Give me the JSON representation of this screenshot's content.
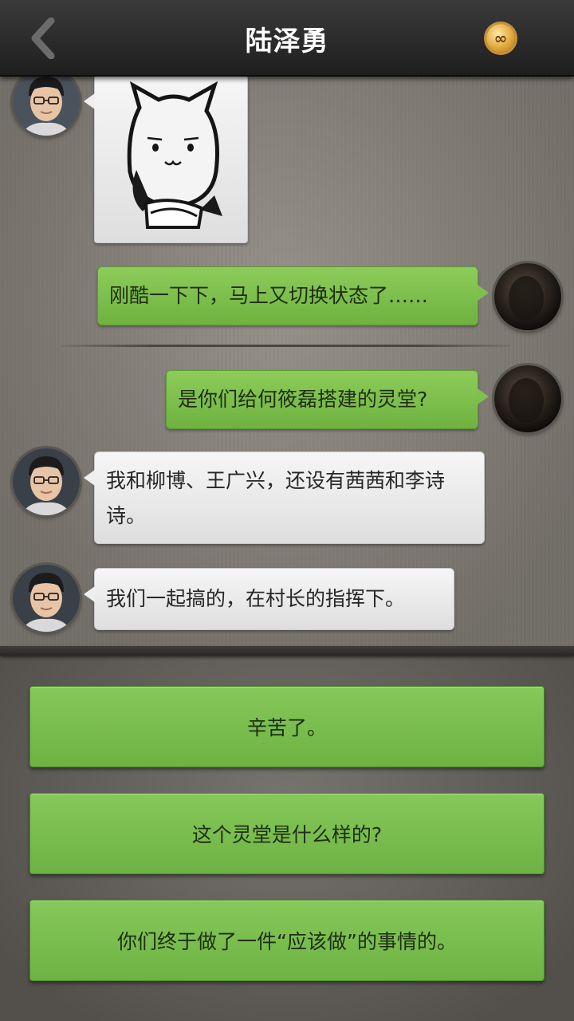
{
  "header": {
    "title": "陆泽勇",
    "back_icon": "chevron-left-icon",
    "coin_icon": "infinity-coin-icon",
    "coin_symbol": "∞"
  },
  "messages": [
    {
      "side": "left",
      "type": "sticker",
      "sticker": "cat-sticker"
    },
    {
      "side": "right",
      "text": "刚酷一下下，马上又切换状态了……"
    },
    {
      "side": "right",
      "text": "是你们给何筱磊搭建的灵堂?"
    },
    {
      "side": "left",
      "text": "我和柳博、王广兴，还设有茜茜和李诗诗。"
    },
    {
      "side": "left",
      "text": "我们一起搞的，在村长的指挥下。"
    }
  ],
  "options": [
    {
      "label": "辛苦了。"
    },
    {
      "label": "这个灵堂是什么样的?"
    },
    {
      "label": "你们终于做了一件“应该做”的事情的。"
    }
  ],
  "colors": {
    "green_bubble": "#7fc04d",
    "white_bubble": "#efefef",
    "header_bg": "#2a2a2a",
    "option_green": "#7bbf4e"
  }
}
